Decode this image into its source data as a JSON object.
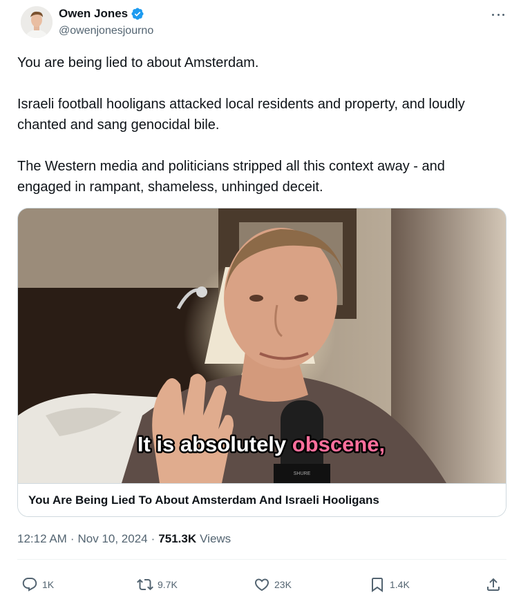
{
  "author": {
    "display_name": "Owen Jones",
    "handle": "@owenjonesjourno"
  },
  "tweet": {
    "paragraphs": [
      "You are being lied to about Amsterdam.",
      "Israeli football hooligans attacked local residents and property, and loudly chanted and sang genocidal bile.",
      "The Western media and politicians stripped all this context away - and engaged in rampant, shameless, unhinged deceit."
    ]
  },
  "media": {
    "subtitle_prefix": "It is absolutely ",
    "subtitle_highlight": "obscene,",
    "mic_label": "SHURE",
    "link_title": "You Are Being Lied To About Amsterdam And Israeli Hooligans"
  },
  "meta": {
    "time": "12:12 AM",
    "sep1": "·",
    "date": "Nov 10, 2024",
    "sep2": "·",
    "views_count": "751.3K",
    "views_label": "Views"
  },
  "actions": {
    "replies": "1K",
    "reposts": "9.7K",
    "likes": "23K",
    "bookmarks": "1.4K"
  },
  "colors": {
    "verified": "#1d9bf0",
    "highlight": "#ff6f9c",
    "text_secondary": "#536471"
  },
  "icons": [
    "verified-badge-icon",
    "more-options-icon",
    "reply-icon",
    "repost-icon",
    "like-icon",
    "bookmark-icon",
    "share-icon"
  ]
}
